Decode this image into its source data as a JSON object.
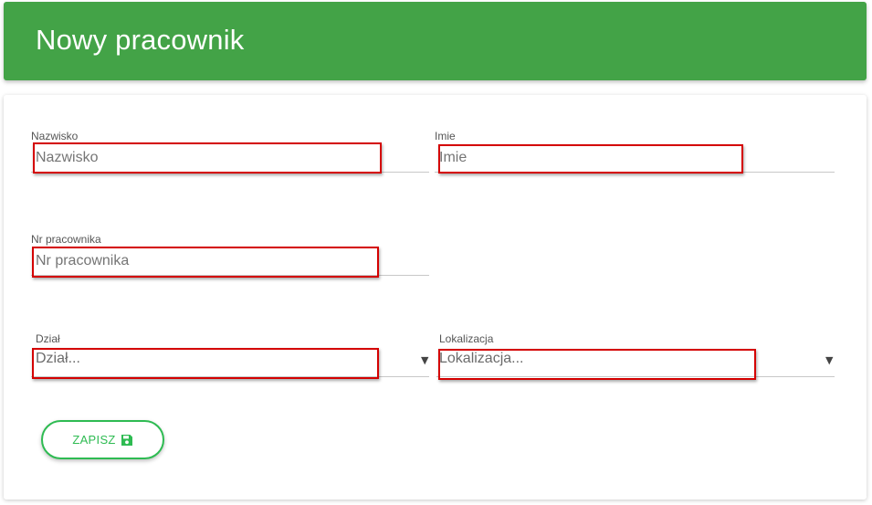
{
  "header": {
    "title": "Nowy pracownik",
    "color": "#43a347"
  },
  "form": {
    "nazwisko": {
      "label": "Nazwisko",
      "placeholder": "Nazwisko"
    },
    "imie": {
      "label": "Imie",
      "placeholder": "Imie"
    },
    "nr_pracownika": {
      "label": "Nr pracownika",
      "placeholder": "Nr pracownika"
    },
    "dzial": {
      "label": "Dział",
      "value": "Dział..."
    },
    "lokalizacja": {
      "label": "Lokalizacja",
      "value": "Lokalizacja..."
    },
    "highlight_color": "#d40000"
  },
  "actions": {
    "save_label": "ZAPISZ",
    "save_icon": "floppy-disk-icon",
    "accent": "#2ebb52"
  }
}
